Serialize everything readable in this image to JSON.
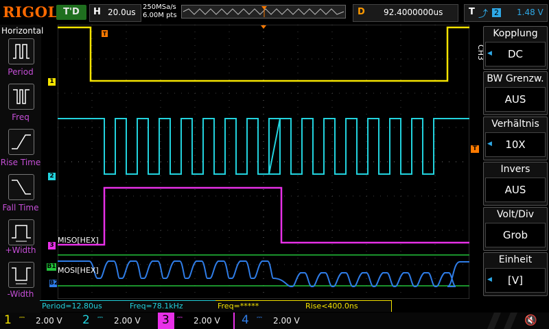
{
  "header": {
    "brand": "RIGOL",
    "trigger_status": "T'D",
    "horizontal_label": "H",
    "timebase": "20.0us",
    "sample_rate": "250MSa/s",
    "memory_depth": "6.00M pts",
    "delay_label": "D",
    "delay_value": "92.4000000us",
    "trigger_label": "T",
    "trigger_source": "2",
    "trigger_level": "1.48 V"
  },
  "left_menu": {
    "title": "Horizontal",
    "items": [
      {
        "label": "Period",
        "icon": "period-icon"
      },
      {
        "label": "Freq",
        "icon": "freq-icon"
      },
      {
        "label": "Rise Time",
        "icon": "rise-time-icon"
      },
      {
        "label": "Fall Time",
        "icon": "fall-time-icon"
      },
      {
        "label": "+Width",
        "icon": "positive-width-icon"
      },
      {
        "label": "-Width",
        "icon": "negative-width-icon"
      }
    ]
  },
  "right_menu": {
    "channel_tag": "CH3",
    "items": [
      {
        "title": "Kopplung",
        "value": "DC"
      },
      {
        "title": "BW Grenzw.",
        "value": "AUS"
      },
      {
        "title": "Verhältnis",
        "value": "10X"
      },
      {
        "title": "Invers",
        "value": "AUS"
      },
      {
        "title": "Volt/Div",
        "value": "Grob"
      },
      {
        "title": "Einheit",
        "value": "[V]"
      }
    ]
  },
  "decoder_labels": {
    "miso": "MISO[HEX]",
    "mosi": "MOSI[HEX]"
  },
  "markers": {
    "ch1": "1",
    "ch2": "2",
    "ch3": "3",
    "b1": "B1",
    "b2": "B2",
    "trigger_pos": "T"
  },
  "measurements": [
    "Period=12.80us",
    "Freq=78.1kHz",
    "Freq=*****",
    "Rise<400.0ns"
  ],
  "channels": [
    {
      "num": "1",
      "scale": "2.00 V",
      "color": "#f5e400"
    },
    {
      "num": "2",
      "scale": "2.00 V",
      "color": "#22d3de"
    },
    {
      "num": "3",
      "scale": "2.00 V",
      "color": "#e830e8"
    },
    {
      "num": "4",
      "scale": "2.00 V",
      "color": "#2f7de8"
    }
  ],
  "colors": {
    "ch1": "#f5e400",
    "ch2": "#22d3de",
    "ch3": "#e830e8",
    "ch4": "#2f7de8",
    "bus": "#22c23a",
    "accent": "#ff7a00"
  }
}
